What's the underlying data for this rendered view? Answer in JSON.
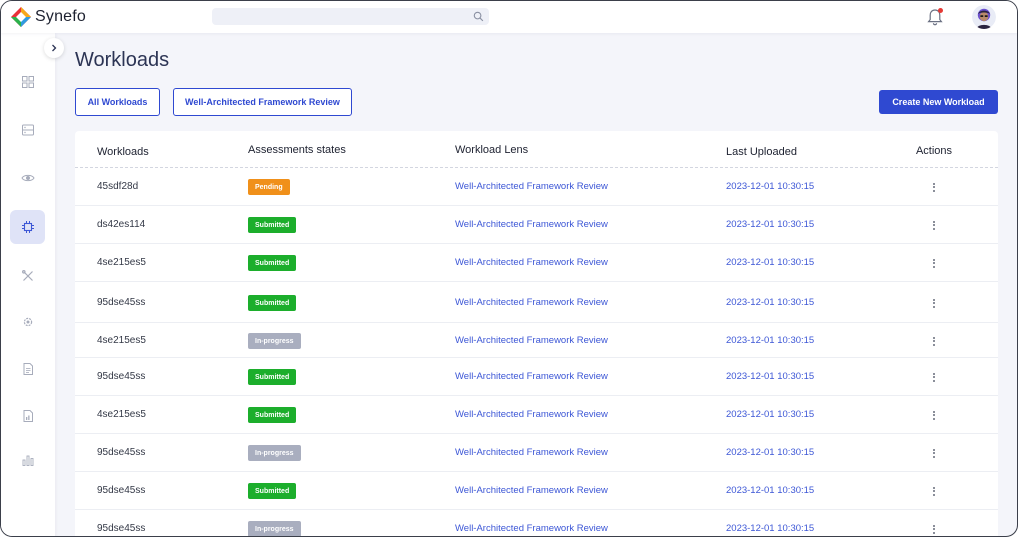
{
  "app": {
    "name": "Synefo"
  },
  "search": {
    "placeholder": ""
  },
  "page": {
    "title": "Workloads"
  },
  "filters": {
    "all_label": "All Workloads",
    "waf_label": "Well-Architected Framework Review"
  },
  "actions": {
    "create_label": "Create New Workload"
  },
  "table": {
    "headers": {
      "workloads": "Workloads",
      "state": "Assessments states",
      "lens": "Workload Lens",
      "uploaded": "Last Uploaded",
      "actions": "Actions"
    },
    "rows": [
      {
        "id": "45sdf28d",
        "state": "Pending",
        "lens": "Well-Architected Framework Review",
        "uploaded": "2023-12-01 10:30:15"
      },
      {
        "id": "ds42es114",
        "state": "Submitted",
        "lens": "Well-Architected Framework Review",
        "uploaded": "2023-12-01 10:30:15"
      },
      {
        "id": "4se215es5",
        "state": "Submitted",
        "lens": "Well-Architected Framework Review",
        "uploaded": "2023-12-01 10:30:15"
      },
      {
        "id": "95dse45ss",
        "state": "Submitted",
        "lens": "Well-Architected Framework Review",
        "uploaded": "2023-12-01 10:30:15"
      },
      {
        "id": "4se215es5",
        "state": "In-progress",
        "lens": "Well-Architected Framework Review",
        "uploaded": "2023-12-01 10:30:15"
      },
      {
        "id": "95dse45ss",
        "state": "Submitted",
        "lens": "Well-Architected Framework Review",
        "uploaded": "2023-12-01 10:30:15"
      },
      {
        "id": "4se215es5",
        "state": "Submitted",
        "lens": "Well-Architected Framework Review",
        "uploaded": "2023-12-01 10:30:15"
      },
      {
        "id": "95dse45ss",
        "state": "In-progress",
        "lens": "Well-Architected Framework Review",
        "uploaded": "2023-12-01 10:30:15"
      },
      {
        "id": "95dse45ss",
        "state": "Submitted",
        "lens": "Well-Architected Framework Review",
        "uploaded": "2023-12-01 10:30:15"
      },
      {
        "id": "95dse45ss",
        "state": "In-progress",
        "lens": "Well-Architected Framework Review",
        "uploaded": "2023-12-01 10:30:15"
      }
    ]
  },
  "state_colors": {
    "Pending": "#f0901a",
    "Submitted": "#1cae2c",
    "In-progress": "#a9aebf"
  },
  "sidebar": {
    "items": [
      {
        "icon": "dashboard-grid-icon"
      },
      {
        "icon": "server-icon"
      },
      {
        "icon": "eye-icon"
      },
      {
        "icon": "cpu-chip-icon",
        "active": true
      },
      {
        "icon": "tools-icon"
      },
      {
        "icon": "settings-icon"
      },
      {
        "icon": "document-icon"
      },
      {
        "icon": "report-icon"
      },
      {
        "icon": "bar-chart-icon"
      }
    ]
  }
}
